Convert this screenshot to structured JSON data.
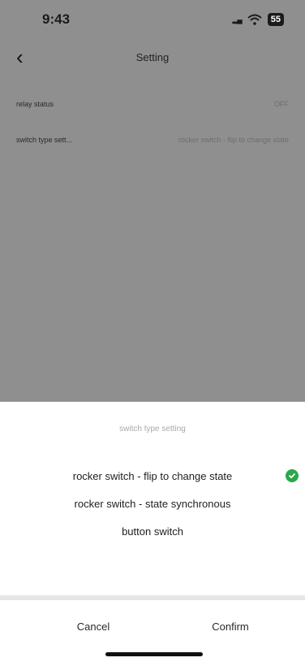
{
  "status_bar": {
    "time": "9:43",
    "signal": "▂▄",
    "battery": "55"
  },
  "nav": {
    "title": "Setting"
  },
  "settings": [
    {
      "label": "relay status",
      "value": "OFF"
    },
    {
      "label": "switch type sett...",
      "value": "rocker switch - flip to change state"
    }
  ],
  "sheet": {
    "title": "switch type setting",
    "options": [
      {
        "label": "rocker switch - flip to change state",
        "selected": true
      },
      {
        "label": "rocker switch - state synchronous",
        "selected": false
      },
      {
        "label": "button switch",
        "selected": false
      }
    ],
    "cancel_label": "Cancel",
    "confirm_label": "Confirm"
  },
  "colors": {
    "overlay": "#8f8f8f",
    "check": "#2aa84a",
    "divider": "#e6e6e6"
  }
}
